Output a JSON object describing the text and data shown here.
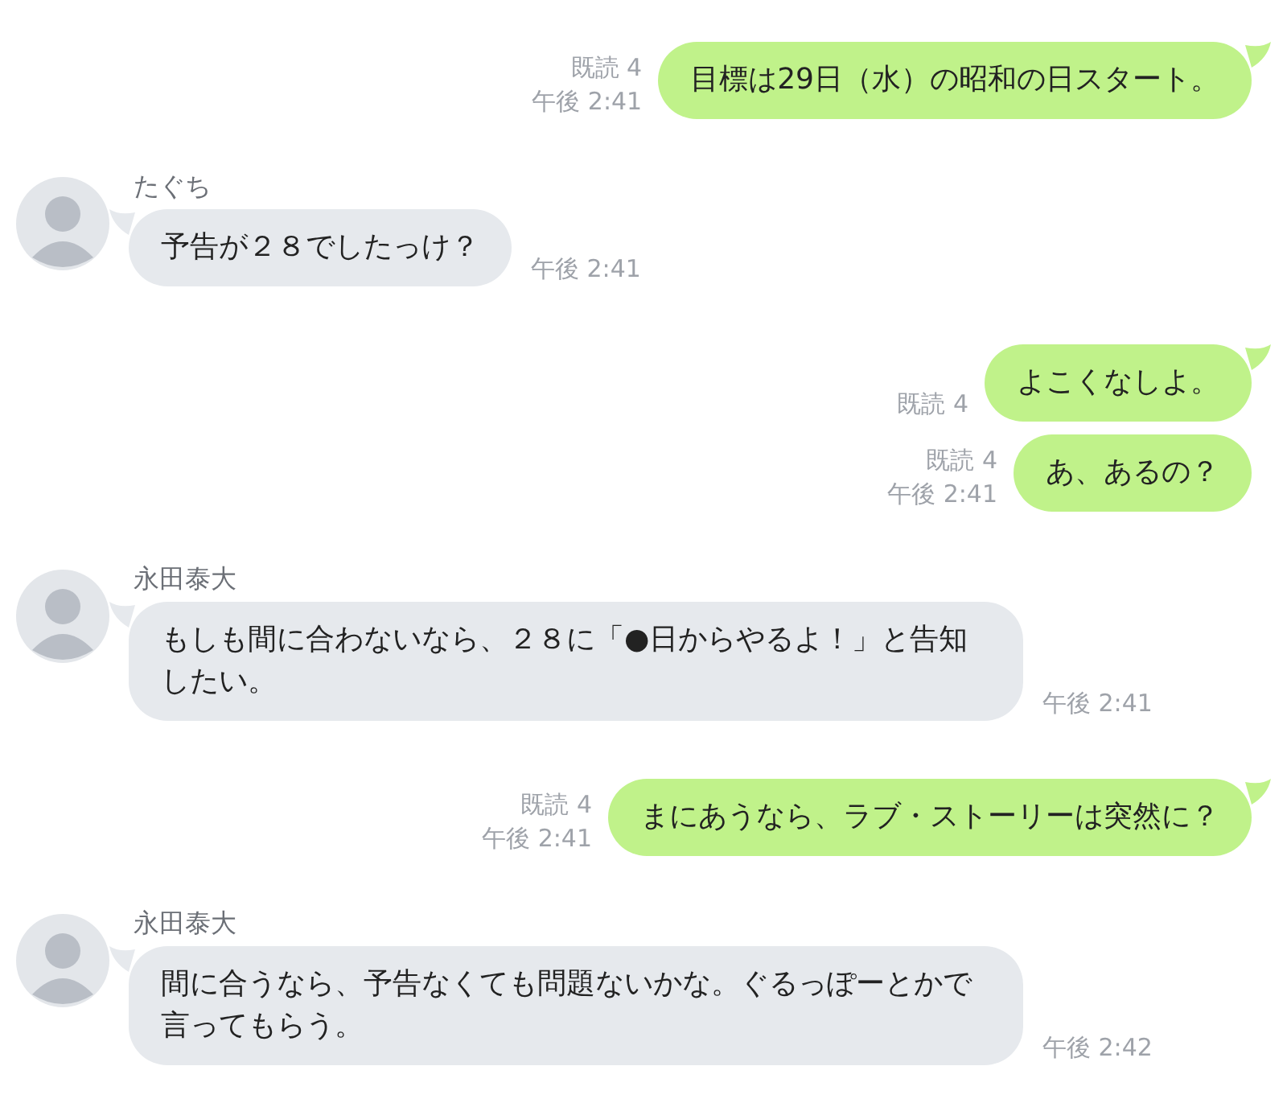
{
  "messages": [
    {
      "kind": "sent",
      "text": "目標は29日（水）の昭和の日スタート。",
      "read": "既読 4",
      "time": "午後 2:41",
      "tail": true
    },
    {
      "kind": "received",
      "sender": "たぐち",
      "text": "予告が２８でしたっけ？",
      "time": "午後 2:41",
      "tail": true
    },
    {
      "kind": "sent",
      "text": "よこくなしよ。",
      "read": "既読 4",
      "tail": true
    },
    {
      "kind": "sent",
      "text": "あ、あるの？",
      "read": "既読 4",
      "time": "午後 2:41",
      "tail": false
    },
    {
      "kind": "received",
      "sender": "永田泰大",
      "text": "もしも間に合わないなら、２８に「●日からやるよ！」と告知したい。",
      "time": "午後 2:41",
      "tail": true
    },
    {
      "kind": "sent",
      "text": "まにあうなら、ラブ・ストーリーは突然に？",
      "read": "既読 4",
      "time": "午後 2:41",
      "tail": true
    },
    {
      "kind": "received",
      "sender": "永田泰大",
      "text": "間に合うなら、予告なくても問題ないかな。ぐるっぽーとかで言ってもらう。",
      "time": "午後 2:42",
      "tail": true
    }
  ]
}
